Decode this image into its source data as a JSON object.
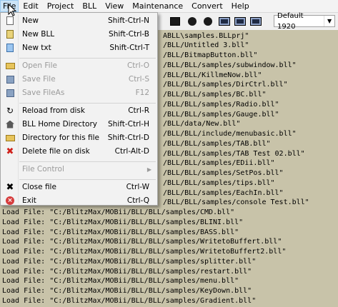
{
  "menubar": {
    "items": [
      "File",
      "Edit",
      "Project",
      "BLL",
      "View",
      "Maintenance",
      "Convert",
      "Help"
    ]
  },
  "toolbar": {
    "build_target": "Default 1920"
  },
  "file_menu": {
    "items": [
      {
        "label": "New",
        "shortcut": "Shift-Ctrl-N",
        "icon": "new-file-icon",
        "enabled": true
      },
      {
        "label": "New BLL",
        "shortcut": "Shift-Ctrl-B",
        "icon": "new-bll-icon",
        "enabled": true
      },
      {
        "label": "New txt",
        "shortcut": "Shift-Ctrl-T",
        "icon": "new-txt-icon",
        "enabled": true
      },
      {
        "label": "Open File",
        "shortcut": "Ctrl-O",
        "icon": "open-folder-icon",
        "enabled": false
      },
      {
        "label": "Save File",
        "shortcut": "Ctrl-S",
        "icon": "save-icon",
        "enabled": false
      },
      {
        "label": "Save FileAs",
        "shortcut": "F12",
        "icon": "save-as-icon",
        "enabled": false
      },
      {
        "label": "Reload from disk",
        "shortcut": "Ctrl-R",
        "icon": "reload-icon",
        "enabled": true
      },
      {
        "label": "BLL Home Directory",
        "shortcut": "Shift-Ctrl-H",
        "icon": "home-icon",
        "enabled": true
      },
      {
        "label": "Directory for this file",
        "shortcut": "Shift-Ctrl-D",
        "icon": "folder-icon",
        "enabled": true
      },
      {
        "label": "Delete file on disk",
        "shortcut": "Ctrl-Alt-D",
        "icon": "delete-icon",
        "enabled": true
      },
      {
        "label": "File Control",
        "shortcut": "",
        "icon": "",
        "enabled": false,
        "submenu": true
      },
      {
        "label": "Close file",
        "shortcut": "Ctrl-W",
        "icon": "close-icon",
        "enabled": true
      },
      {
        "label": "Exit",
        "shortcut": "Ctrl-Q",
        "icon": "exit-icon",
        "enabled": true
      }
    ]
  },
  "output": {
    "lines": [
      "ABLL\\samples.BLLprj\"",
      "/BLL/Untitled 3.bll\"",
      "/BLL/BitmapButton.bll\"",
      "/BLL/BLL/samples/subwindow.bll\"",
      "/BLL/BLL/KillmeNow.bll\"",
      "/BLL/BLL/samples/DirCtrl.bll\"",
      "/BLL/BLL/samples/BC.bll\"",
      "/BLL/BLL/samples/Radio.bll\"",
      "/BLL/BLL/samples/Gauge.bll\"",
      "/BLL/data/New.bll\"",
      "/BLL/BLL/include/menubasic.bll\"",
      "/BLL/BLL/samples/TAB.bll\"",
      "/BLL/BLL/samples/TAB Test 02.bll\"",
      "/BLL/BLL/samples/EDii.bll\"",
      "/BLL/BLL/samples/SetPos.bll\"",
      "/BLL/BLL/samples/tips.bll\"",
      "/BLL/BLL/samples/EachIn.bll\"",
      "/BLL/BLL/samples/console Test.bll\"",
      "Load File: \"C:/BlitzMax/MOBii/BLL/BLL/samples/CMD.bll\"",
      "Load File: \"C:/BlitzMax/MOBii/BLL/BLL/samples/BLINI.bll\"",
      "Load File: \"C:/BlitzMax/MOBii/BLL/BLL/samples/BASS.bll\"",
      "Load File: \"C:/BlitzMax/MOBii/BLL/BLL/samples/WritetoBuffert.bll\"",
      "Load File: \"C:/BlitzMax/MOBii/BLL/BLL/samples/WritetoBuffert2.bll\"",
      "Load File: \"C:/BlitzMax/MOBii/BLL/BLL/samples/splitter.bll\"",
      "Load File: \"C:/BlitzMax/MOBii/BLL/BLL/samples/restart.bll\"",
      "Load File: \"C:/BlitzMax/MOBii/BLL/BLL/samples/menu.bll\"",
      "Load File: \"C:/BlitzMax/MOBii/BLL/BLL/samples/KeyDown.bll\"",
      "Load File: \"C:/BlitzMax/MOBii/BLL/BLL/samples/Gradient.bll\""
    ]
  }
}
